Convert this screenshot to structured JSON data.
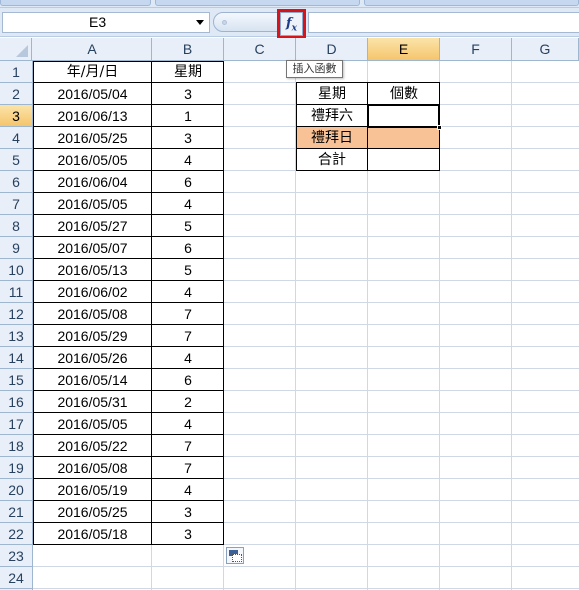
{
  "formula_bar": {
    "name_box": "E3",
    "fx_label": "fx",
    "formula": ""
  },
  "tooltip": "插入函數",
  "columns": [
    "A",
    "B",
    "C",
    "D",
    "E",
    "F",
    "G"
  ],
  "rows": [
    "1",
    "2",
    "3",
    "4",
    "5",
    "6",
    "7",
    "8",
    "9",
    "10",
    "11",
    "12",
    "13",
    "14",
    "15",
    "16",
    "17",
    "18",
    "19",
    "20",
    "21",
    "22",
    "23",
    "24"
  ],
  "selected_cell": "E3",
  "table_a": {
    "headers": [
      "年/月/日",
      "星期"
    ],
    "records": [
      [
        "2016/05/04",
        "3"
      ],
      [
        "2016/06/13",
        "1"
      ],
      [
        "2016/05/25",
        "3"
      ],
      [
        "2016/05/05",
        "4"
      ],
      [
        "2016/06/04",
        "6"
      ],
      [
        "2016/05/05",
        "4"
      ],
      [
        "2016/05/27",
        "5"
      ],
      [
        "2016/05/07",
        "6"
      ],
      [
        "2016/05/13",
        "5"
      ],
      [
        "2016/06/02",
        "4"
      ],
      [
        "2016/05/08",
        "7"
      ],
      [
        "2016/05/29",
        "7"
      ],
      [
        "2016/05/26",
        "4"
      ],
      [
        "2016/05/14",
        "6"
      ],
      [
        "2016/05/31",
        "2"
      ],
      [
        "2016/05/05",
        "4"
      ],
      [
        "2016/05/22",
        "7"
      ],
      [
        "2016/05/08",
        "7"
      ],
      [
        "2016/05/19",
        "4"
      ],
      [
        "2016/05/25",
        "3"
      ],
      [
        "2016/05/18",
        "3"
      ]
    ]
  },
  "table_d": {
    "headers": [
      "星期",
      "個數"
    ],
    "rows": [
      [
        "禮拜六",
        ""
      ],
      [
        "禮拜日",
        ""
      ]
    ],
    "total_label": "合計",
    "total_value": "",
    "total_fill": "#f9c296"
  },
  "colors": {
    "selected_header": "#f5c56c",
    "fx_highlight": "#d6141a"
  }
}
